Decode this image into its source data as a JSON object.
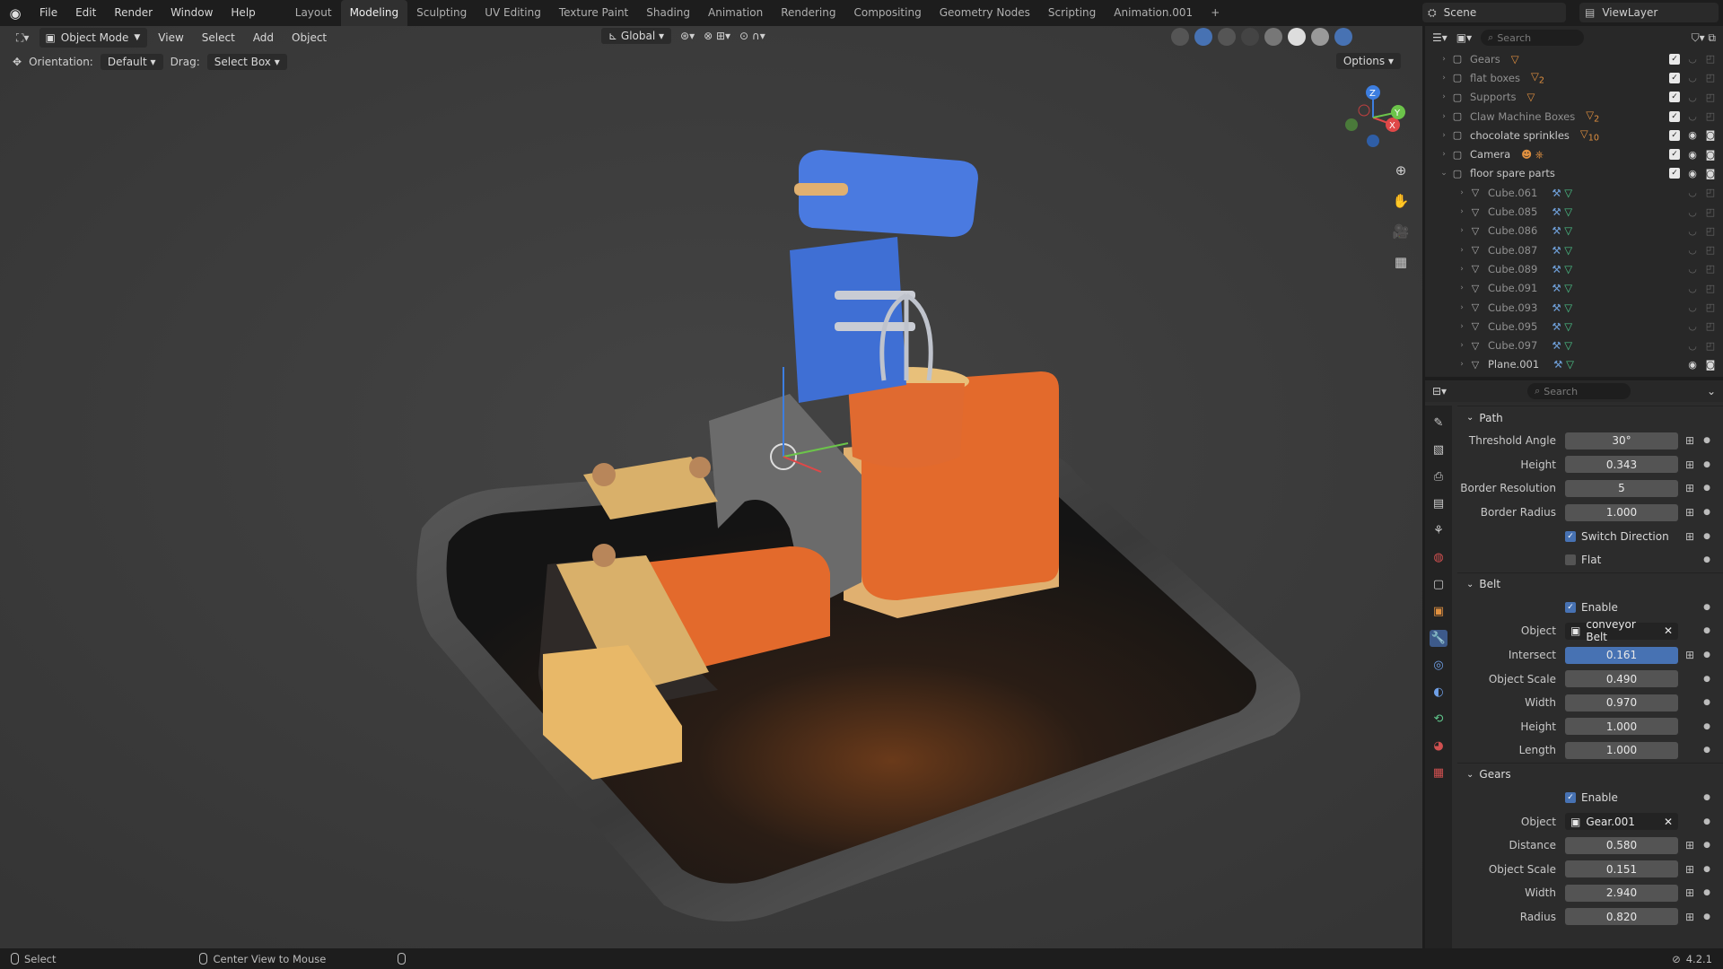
{
  "menubar": {
    "items": [
      "File",
      "Edit",
      "Render",
      "Window",
      "Help"
    ],
    "workspaces": [
      "Layout",
      "Modeling",
      "Sculpting",
      "UV Editing",
      "Texture Paint",
      "Shading",
      "Animation",
      "Rendering",
      "Compositing",
      "Geometry Nodes",
      "Scripting",
      "Animation.001"
    ],
    "active_workspace": "Modeling",
    "add_tab": "+",
    "scene": "Scene",
    "view_layer": "ViewLayer"
  },
  "viewport": {
    "mode": "Object Mode",
    "menus": [
      "View",
      "Select",
      "Add",
      "Object"
    ],
    "transform_orientation": "Global",
    "orientation_label": "Orientation:",
    "orientation_value": "Default",
    "drag_label": "Drag:",
    "drag_value": "Select Box",
    "options": "Options"
  },
  "outliner": {
    "search_placeholder": "Search",
    "rows": [
      {
        "label": "Gears",
        "badge": "",
        "dim": true
      },
      {
        "label": "flat boxes",
        "badge": "2",
        "dim": true
      },
      {
        "label": "Supports",
        "badge": "",
        "dim": true
      },
      {
        "label": "Claw Machine Boxes",
        "badge": "2",
        "dim": true
      },
      {
        "label": "chocolate sprinkles",
        "badge": "10",
        "dim": false
      },
      {
        "label": "Camera",
        "badge": "",
        "dim": false
      },
      {
        "label": "floor spare parts",
        "badge": "",
        "dim": false
      },
      {
        "label": "Cube.061",
        "badge": "",
        "dim": true
      },
      {
        "label": "Cube.085",
        "badge": "",
        "dim": true
      },
      {
        "label": "Cube.086",
        "badge": "",
        "dim": true
      },
      {
        "label": "Cube.087",
        "badge": "",
        "dim": true
      },
      {
        "label": "Cube.089",
        "badge": "",
        "dim": true
      },
      {
        "label": "Cube.091",
        "badge": "",
        "dim": true
      },
      {
        "label": "Cube.093",
        "badge": "",
        "dim": true
      },
      {
        "label": "Cube.095",
        "badge": "",
        "dim": true
      },
      {
        "label": "Cube.097",
        "badge": "",
        "dim": true
      },
      {
        "label": "Plane.001",
        "badge": "",
        "dim": false
      }
    ]
  },
  "properties": {
    "search_placeholder": "Search",
    "path": {
      "title": "Path",
      "threshold_angle_label": "Threshold Angle",
      "threshold_angle": "30°",
      "height_label": "Height",
      "height": "0.343",
      "border_resolution_label": "Border Resolution",
      "border_resolution": "5",
      "border_radius_label": "Border Radius",
      "border_radius": "1.000",
      "switch_direction_label": "Switch Direction",
      "switch_direction": true,
      "flat_label": "Flat",
      "flat": false
    },
    "belt": {
      "title": "Belt",
      "enable_label": "Enable",
      "enable": true,
      "object_label": "Object",
      "object": "conveyor Belt",
      "intersect_label": "Intersect",
      "intersect": "0.161",
      "object_scale_label": "Object Scale",
      "object_scale": "0.490",
      "width_label": "Width",
      "width": "0.970",
      "height_label": "Height",
      "height": "1.000",
      "length_label": "Length",
      "length": "1.000"
    },
    "gears": {
      "title": "Gears",
      "enable_label": "Enable",
      "enable": true,
      "object_label": "Object",
      "object": "Gear.001",
      "distance_label": "Distance",
      "distance": "0.580",
      "object_scale_label": "Object Scale",
      "object_scale": "0.151",
      "width_label": "Width",
      "width": "2.940",
      "radius_label": "Radius",
      "radius": "0.820"
    }
  },
  "statusbar": {
    "select": "Select",
    "center_view": "Center View to Mouse",
    "version": "4.2.1"
  },
  "colors": {
    "accent": "#4772b3",
    "orange_body": "#e06a30",
    "blue_body": "#3f6fd4",
    "cream": "#e8c07a",
    "tray": "#202020"
  }
}
